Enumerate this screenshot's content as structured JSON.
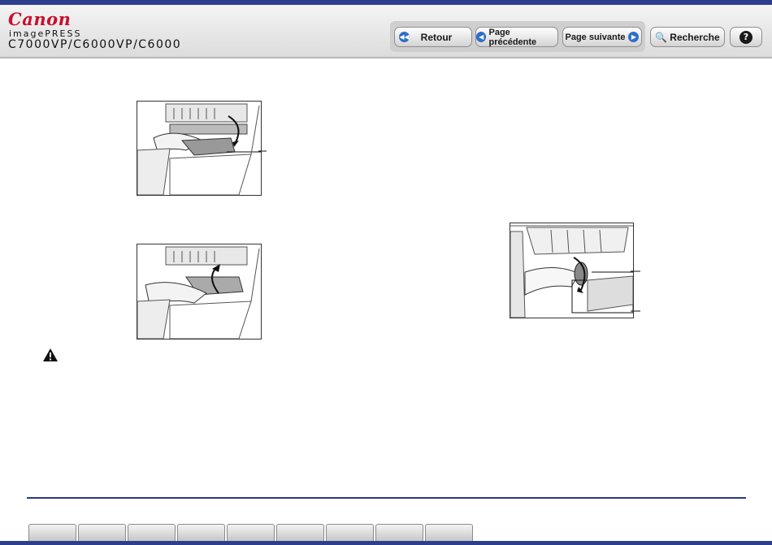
{
  "header": {
    "brand": "Canon",
    "product": "imagePRESS",
    "model": "C7000VP/C6000VP/C6000"
  },
  "nav": {
    "back_label": "Retour",
    "prev_label": "Page précédente",
    "next_label": "Page suivante",
    "search_label": "Recherche",
    "help_label": "?"
  },
  "icons": {
    "back": "double-arrow-left-icon",
    "prev": "arrow-left-icon",
    "next": "arrow-right-icon",
    "search": "magnifier-icon",
    "help": "question-icon",
    "warning": "warning-triangle-icon"
  },
  "colors": {
    "accent": "#2c3f8f",
    "brand": "#c8102e",
    "button_icon": "#2e6fc9"
  },
  "tabs": [
    "",
    "",
    "",
    "",
    "",
    "",
    "",
    "",
    "",
    ""
  ]
}
